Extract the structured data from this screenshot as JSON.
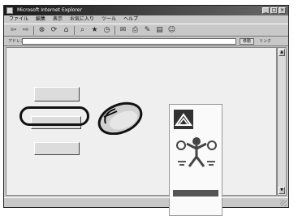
{
  "window": {
    "title": "Microsoft Internet Explorer",
    "buttons": [
      "_",
      "□",
      "×"
    ]
  },
  "menu": [
    "ファイル",
    "編集",
    "表示",
    "お気に入り",
    "ツール",
    "ヘルプ"
  ],
  "toolbar_icons": [
    "back-icon",
    "forward-icon",
    "stop-icon",
    "refresh-icon",
    "home-icon",
    "search-icon",
    "favorites-icon",
    "history-icon",
    "mail-icon",
    "print-icon",
    "edit-icon",
    "discuss-icon",
    "messenger-icon"
  ],
  "address": {
    "label": "アドレス",
    "value": "",
    "go": "移動",
    "links": "リンク"
  },
  "page": {
    "heading": "",
    "buttons": [
      {
        "line1": "",
        "line2": "",
        "desc": ""
      },
      {
        "line1": "",
        "line2": "",
        "desc": ""
      },
      {
        "line1": "",
        "line2": "",
        "desc": ""
      }
    ],
    "page_number": ""
  },
  "status": {
    "left": "",
    "right": ""
  },
  "colors": {
    "titlebar": "#1a1a1a",
    "background": "#efefef",
    "highlight_ring": "#111111"
  }
}
